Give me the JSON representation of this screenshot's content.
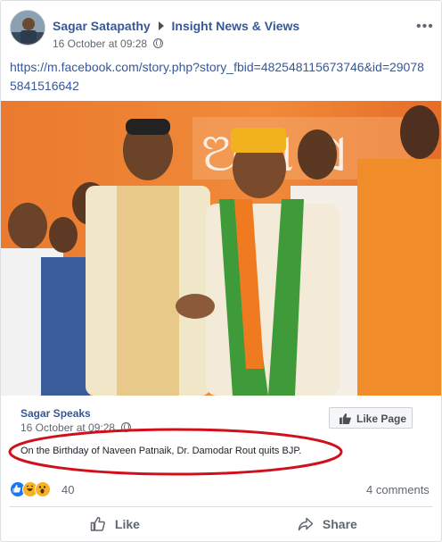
{
  "post": {
    "author": "Sagar Satapathy",
    "group": "Insight News & Views",
    "timestamp": "16 October at 09:28",
    "link": "https://m.facebook.com/story.php?story_fbid=482548115673746&id=290785841516642"
  },
  "shared": {
    "page_name": "Sagar Speaks",
    "timestamp": "16 October at 09:28",
    "like_page_label": "Like Page",
    "text": "On the Birthday of Naveen Patnaik, Dr. Damodar Rout quits BJP."
  },
  "engagement": {
    "reaction_count": "40",
    "comments": "4 comments"
  },
  "actions": {
    "like_label": "Like",
    "share_label": "Share"
  },
  "colors": {
    "link": "#365899",
    "muted": "#606770",
    "annotation_red": "#d0111b",
    "backdrop_orange": "#e8732d"
  },
  "icons": [
    "globe-icon",
    "more-options-icon",
    "like-reaction-icon",
    "haha-reaction-icon",
    "wow-reaction-icon",
    "thumbs-up-icon",
    "share-arrow-icon"
  ]
}
